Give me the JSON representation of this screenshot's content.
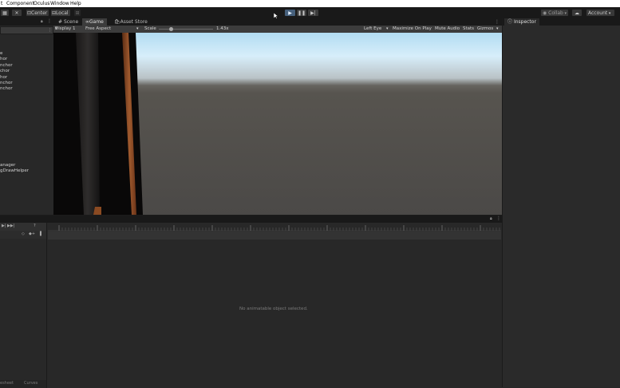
{
  "menu": {
    "items": [
      "t",
      "Component",
      "Oculus",
      "Window",
      "Help"
    ]
  },
  "toolbar": {
    "pivot_center": "Center",
    "pivot_local": "Local",
    "collab": "Collab",
    "account": "Account"
  },
  "hierarchy": {
    "items": [
      "e",
      "hor",
      "nchor",
      "chor",
      "hor",
      "nchor",
      "nchor",
      "anager",
      "gDrawHelper"
    ]
  },
  "game_view": {
    "tabs": [
      "Scene",
      "Game",
      "Asset Store"
    ],
    "display": "Display 1",
    "aspect": "Free Aspect",
    "scale_label": "Scale",
    "scale_value": "1.43x",
    "eye": "Left Eye",
    "maximize": "Maximize On Play",
    "mute": "Mute Audio",
    "stats": "Stats",
    "gizmos": "Gizmos"
  },
  "inspector": {
    "tab": "Inspector"
  },
  "animation": {
    "empty_message": "No animatable object selected.",
    "tabs": [
      "esheet",
      "Curves"
    ]
  },
  "colors": {
    "sky_top": "#b3dff7",
    "horizon": "#5b5a57",
    "ground": "#4c4a48",
    "play_accent": "#46607c"
  }
}
